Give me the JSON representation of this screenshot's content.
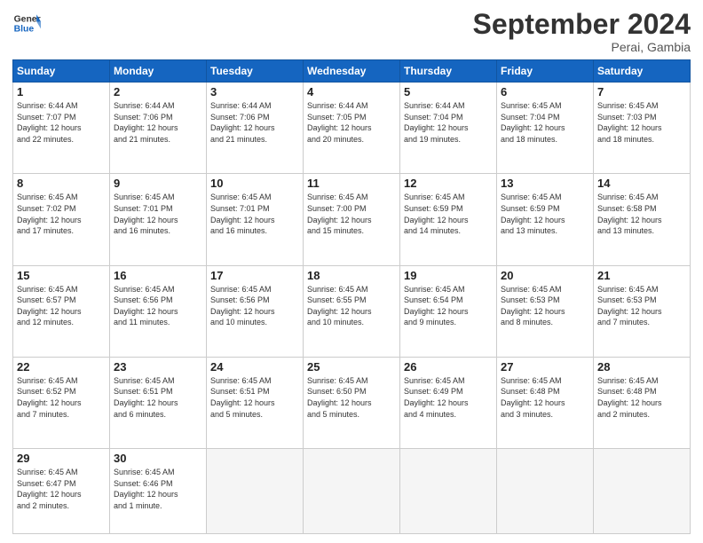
{
  "logo": {
    "line1": "General",
    "line2": "Blue"
  },
  "title": "September 2024",
  "subtitle": "Perai, Gambia",
  "headers": [
    "Sunday",
    "Monday",
    "Tuesday",
    "Wednesday",
    "Thursday",
    "Friday",
    "Saturday"
  ],
  "weeks": [
    [
      {
        "day": "1",
        "info": "Sunrise: 6:44 AM\nSunset: 7:07 PM\nDaylight: 12 hours\nand 22 minutes."
      },
      {
        "day": "2",
        "info": "Sunrise: 6:44 AM\nSunset: 7:06 PM\nDaylight: 12 hours\nand 21 minutes."
      },
      {
        "day": "3",
        "info": "Sunrise: 6:44 AM\nSunset: 7:06 PM\nDaylight: 12 hours\nand 21 minutes."
      },
      {
        "day": "4",
        "info": "Sunrise: 6:44 AM\nSunset: 7:05 PM\nDaylight: 12 hours\nand 20 minutes."
      },
      {
        "day": "5",
        "info": "Sunrise: 6:44 AM\nSunset: 7:04 PM\nDaylight: 12 hours\nand 19 minutes."
      },
      {
        "day": "6",
        "info": "Sunrise: 6:45 AM\nSunset: 7:04 PM\nDaylight: 12 hours\nand 18 minutes."
      },
      {
        "day": "7",
        "info": "Sunrise: 6:45 AM\nSunset: 7:03 PM\nDaylight: 12 hours\nand 18 minutes."
      }
    ],
    [
      {
        "day": "8",
        "info": "Sunrise: 6:45 AM\nSunset: 7:02 PM\nDaylight: 12 hours\nand 17 minutes."
      },
      {
        "day": "9",
        "info": "Sunrise: 6:45 AM\nSunset: 7:01 PM\nDaylight: 12 hours\nand 16 minutes."
      },
      {
        "day": "10",
        "info": "Sunrise: 6:45 AM\nSunset: 7:01 PM\nDaylight: 12 hours\nand 16 minutes."
      },
      {
        "day": "11",
        "info": "Sunrise: 6:45 AM\nSunset: 7:00 PM\nDaylight: 12 hours\nand 15 minutes."
      },
      {
        "day": "12",
        "info": "Sunrise: 6:45 AM\nSunset: 6:59 PM\nDaylight: 12 hours\nand 14 minutes."
      },
      {
        "day": "13",
        "info": "Sunrise: 6:45 AM\nSunset: 6:59 PM\nDaylight: 12 hours\nand 13 minutes."
      },
      {
        "day": "14",
        "info": "Sunrise: 6:45 AM\nSunset: 6:58 PM\nDaylight: 12 hours\nand 13 minutes."
      }
    ],
    [
      {
        "day": "15",
        "info": "Sunrise: 6:45 AM\nSunset: 6:57 PM\nDaylight: 12 hours\nand 12 minutes."
      },
      {
        "day": "16",
        "info": "Sunrise: 6:45 AM\nSunset: 6:56 PM\nDaylight: 12 hours\nand 11 minutes."
      },
      {
        "day": "17",
        "info": "Sunrise: 6:45 AM\nSunset: 6:56 PM\nDaylight: 12 hours\nand 10 minutes."
      },
      {
        "day": "18",
        "info": "Sunrise: 6:45 AM\nSunset: 6:55 PM\nDaylight: 12 hours\nand 10 minutes."
      },
      {
        "day": "19",
        "info": "Sunrise: 6:45 AM\nSunset: 6:54 PM\nDaylight: 12 hours\nand 9 minutes."
      },
      {
        "day": "20",
        "info": "Sunrise: 6:45 AM\nSunset: 6:53 PM\nDaylight: 12 hours\nand 8 minutes."
      },
      {
        "day": "21",
        "info": "Sunrise: 6:45 AM\nSunset: 6:53 PM\nDaylight: 12 hours\nand 7 minutes."
      }
    ],
    [
      {
        "day": "22",
        "info": "Sunrise: 6:45 AM\nSunset: 6:52 PM\nDaylight: 12 hours\nand 7 minutes."
      },
      {
        "day": "23",
        "info": "Sunrise: 6:45 AM\nSunset: 6:51 PM\nDaylight: 12 hours\nand 6 minutes."
      },
      {
        "day": "24",
        "info": "Sunrise: 6:45 AM\nSunset: 6:51 PM\nDaylight: 12 hours\nand 5 minutes."
      },
      {
        "day": "25",
        "info": "Sunrise: 6:45 AM\nSunset: 6:50 PM\nDaylight: 12 hours\nand 5 minutes."
      },
      {
        "day": "26",
        "info": "Sunrise: 6:45 AM\nSunset: 6:49 PM\nDaylight: 12 hours\nand 4 minutes."
      },
      {
        "day": "27",
        "info": "Sunrise: 6:45 AM\nSunset: 6:48 PM\nDaylight: 12 hours\nand 3 minutes."
      },
      {
        "day": "28",
        "info": "Sunrise: 6:45 AM\nSunset: 6:48 PM\nDaylight: 12 hours\nand 2 minutes."
      }
    ],
    [
      {
        "day": "29",
        "info": "Sunrise: 6:45 AM\nSunset: 6:47 PM\nDaylight: 12 hours\nand 2 minutes."
      },
      {
        "day": "30",
        "info": "Sunrise: 6:45 AM\nSunset: 6:46 PM\nDaylight: 12 hours\nand 1 minute."
      },
      {
        "day": "",
        "info": ""
      },
      {
        "day": "",
        "info": ""
      },
      {
        "day": "",
        "info": ""
      },
      {
        "day": "",
        "info": ""
      },
      {
        "day": "",
        "info": ""
      }
    ]
  ]
}
